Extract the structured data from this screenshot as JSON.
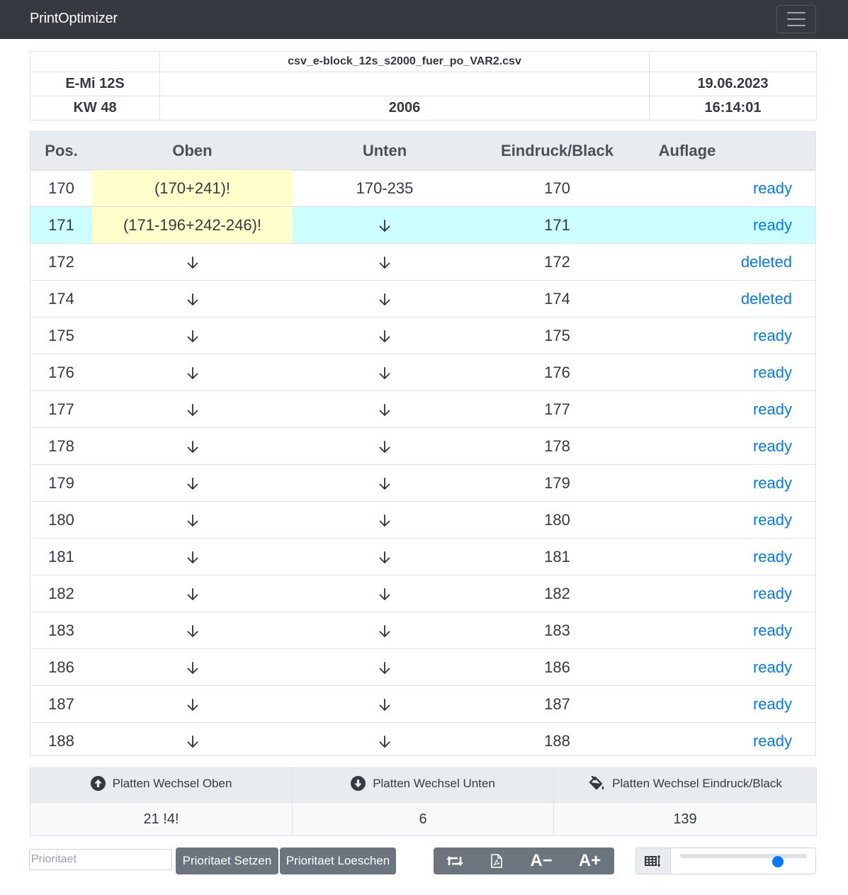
{
  "app": {
    "brand": "PrintOptimizer"
  },
  "info": {
    "filename": "csv_e-block_12s_s2000_fuer_po_VAR2.csv",
    "machine": "E-Mi 12S",
    "date": "19.06.2023",
    "week": "KW 48",
    "number": "2006",
    "time": "16:14:01"
  },
  "table": {
    "headers": {
      "pos": "Pos.",
      "oben": "Oben",
      "unten": "Unten",
      "eindruck": "Eindruck/Black",
      "auflage": "Auflage"
    },
    "rows": [
      {
        "pos": "170",
        "oben": "(170+241)!",
        "unten": "170-235",
        "eindruck": "170",
        "auflage": "ready"
      },
      {
        "pos": "171",
        "oben": "(171-196+242-246)!",
        "unten": "↓",
        "eindruck": "171",
        "auflage": "ready"
      },
      {
        "pos": "172",
        "oben": "↓",
        "unten": "↓",
        "eindruck": "172",
        "auflage": "deleted"
      },
      {
        "pos": "174",
        "oben": "↓",
        "unten": "↓",
        "eindruck": "174",
        "auflage": "deleted"
      },
      {
        "pos": "175",
        "oben": "↓",
        "unten": "↓",
        "eindruck": "175",
        "auflage": "ready"
      },
      {
        "pos": "176",
        "oben": "↓",
        "unten": "↓",
        "eindruck": "176",
        "auflage": "ready"
      },
      {
        "pos": "177",
        "oben": "↓",
        "unten": "↓",
        "eindruck": "177",
        "auflage": "ready"
      },
      {
        "pos": "178",
        "oben": "↓",
        "unten": "↓",
        "eindruck": "178",
        "auflage": "ready"
      },
      {
        "pos": "179",
        "oben": "↓",
        "unten": "↓",
        "eindruck": "179",
        "auflage": "ready"
      },
      {
        "pos": "180",
        "oben": "↓",
        "unten": "↓",
        "eindruck": "180",
        "auflage": "ready"
      },
      {
        "pos": "181",
        "oben": "↓",
        "unten": "↓",
        "eindruck": "181",
        "auflage": "ready"
      },
      {
        "pos": "182",
        "oben": "↓",
        "unten": "↓",
        "eindruck": "182",
        "auflage": "ready"
      },
      {
        "pos": "183",
        "oben": "↓",
        "unten": "↓",
        "eindruck": "183",
        "auflage": "ready"
      },
      {
        "pos": "186",
        "oben": "↓",
        "unten": "↓",
        "eindruck": "186",
        "auflage": "ready"
      },
      {
        "pos": "187",
        "oben": "↓",
        "unten": "↓",
        "eindruck": "187",
        "auflage": "ready"
      },
      {
        "pos": "188",
        "oben": "↓",
        "unten": "↓",
        "eindruck": "188",
        "auflage": "ready"
      }
    ]
  },
  "stats": {
    "oben_label": "Platten Wechsel Oben",
    "unten_label": "Platten Wechsel Unten",
    "eindruck_label": "Platten Wechsel Eindruck/Black",
    "oben_value": "21 !4!",
    "unten_value": "6",
    "eindruck_value": "139"
  },
  "controls": {
    "prio_placeholder": "Prioritaet",
    "set_label": "Prioritaet Setzen",
    "delete_label": "Prioritaet Loeschen",
    "font_smaller": "A−",
    "font_larger": "A+",
    "zoom_level": 0.8
  },
  "colors": {
    "navbar": "#343a40",
    "link": "#007bff",
    "highlight_yellow": "#ffffcc",
    "selected_row": "#ccfdff",
    "button": "#6c757d"
  }
}
